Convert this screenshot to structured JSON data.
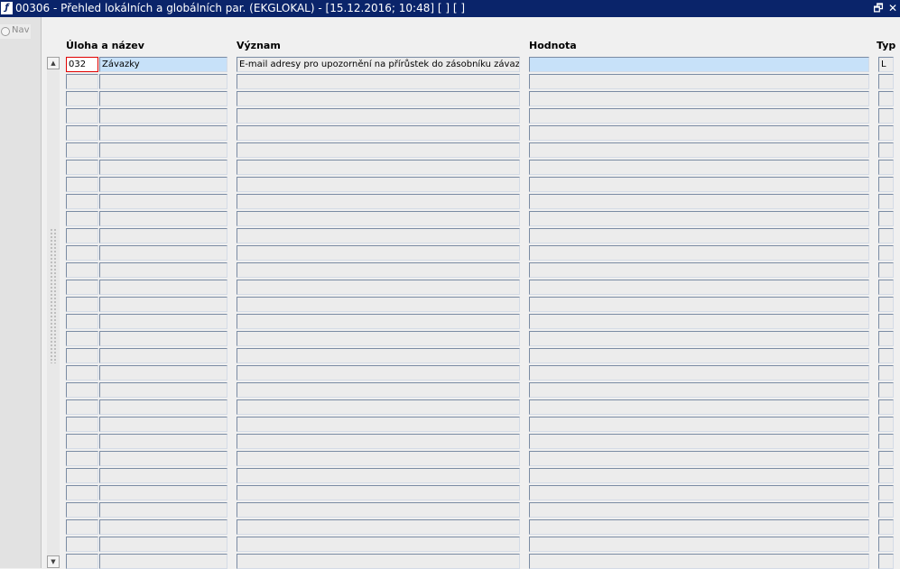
{
  "window": {
    "app_icon": "ef-logo-icon",
    "title": "00306 - Přehled lokálních a globálních par. (EKGLOKAL) - [15.12.2016; 10:48]  [ ] [ ]",
    "restore_glyph": "🗗",
    "close_glyph": "✕"
  },
  "nav": {
    "label": "Nav"
  },
  "columns": {
    "uloha": "Úloha a název",
    "vyznam": "Význam",
    "hodnota": "Hodnota",
    "typ": "Typ"
  },
  "scrollbar": {
    "up_glyph": "▲",
    "down_glyph": "▼"
  },
  "rows": [
    {
      "code": "032",
      "name": "Závazky",
      "meaning": "E-mail adresy pro upozornění na přírůstek do zásobníku závazků",
      "value": "",
      "type": "L"
    },
    {
      "code": "",
      "name": "",
      "meaning": "",
      "value": "",
      "type": ""
    },
    {
      "code": "",
      "name": "",
      "meaning": "",
      "value": "",
      "type": ""
    },
    {
      "code": "",
      "name": "",
      "meaning": "",
      "value": "",
      "type": ""
    },
    {
      "code": "",
      "name": "",
      "meaning": "",
      "value": "",
      "type": ""
    },
    {
      "code": "",
      "name": "",
      "meaning": "",
      "value": "",
      "type": ""
    },
    {
      "code": "",
      "name": "",
      "meaning": "",
      "value": "",
      "type": ""
    },
    {
      "code": "",
      "name": "",
      "meaning": "",
      "value": "",
      "type": ""
    },
    {
      "code": "",
      "name": "",
      "meaning": "",
      "value": "",
      "type": ""
    },
    {
      "code": "",
      "name": "",
      "meaning": "",
      "value": "",
      "type": ""
    },
    {
      "code": "",
      "name": "",
      "meaning": "",
      "value": "",
      "type": ""
    },
    {
      "code": "",
      "name": "",
      "meaning": "",
      "value": "",
      "type": ""
    },
    {
      "code": "",
      "name": "",
      "meaning": "",
      "value": "",
      "type": ""
    },
    {
      "code": "",
      "name": "",
      "meaning": "",
      "value": "",
      "type": ""
    },
    {
      "code": "",
      "name": "",
      "meaning": "",
      "value": "",
      "type": ""
    },
    {
      "code": "",
      "name": "",
      "meaning": "",
      "value": "",
      "type": ""
    },
    {
      "code": "",
      "name": "",
      "meaning": "",
      "value": "",
      "type": ""
    },
    {
      "code": "",
      "name": "",
      "meaning": "",
      "value": "",
      "type": ""
    },
    {
      "code": "",
      "name": "",
      "meaning": "",
      "value": "",
      "type": ""
    },
    {
      "code": "",
      "name": "",
      "meaning": "",
      "value": "",
      "type": ""
    },
    {
      "code": "",
      "name": "",
      "meaning": "",
      "value": "",
      "type": ""
    },
    {
      "code": "",
      "name": "",
      "meaning": "",
      "value": "",
      "type": ""
    },
    {
      "code": "",
      "name": "",
      "meaning": "",
      "value": "",
      "type": ""
    },
    {
      "code": "",
      "name": "",
      "meaning": "",
      "value": "",
      "type": ""
    },
    {
      "code": "",
      "name": "",
      "meaning": "",
      "value": "",
      "type": ""
    },
    {
      "code": "",
      "name": "",
      "meaning": "",
      "value": "",
      "type": ""
    },
    {
      "code": "",
      "name": "",
      "meaning": "",
      "value": "",
      "type": ""
    },
    {
      "code": "",
      "name": "",
      "meaning": "",
      "value": "",
      "type": ""
    },
    {
      "code": "",
      "name": "",
      "meaning": "",
      "value": "",
      "type": ""
    },
    {
      "code": "",
      "name": "",
      "meaning": "",
      "value": "",
      "type": ""
    }
  ],
  "colors": {
    "titlebar": "#0a246a",
    "selected_row": "#c7e1f9",
    "focus_border": "#e00000"
  }
}
